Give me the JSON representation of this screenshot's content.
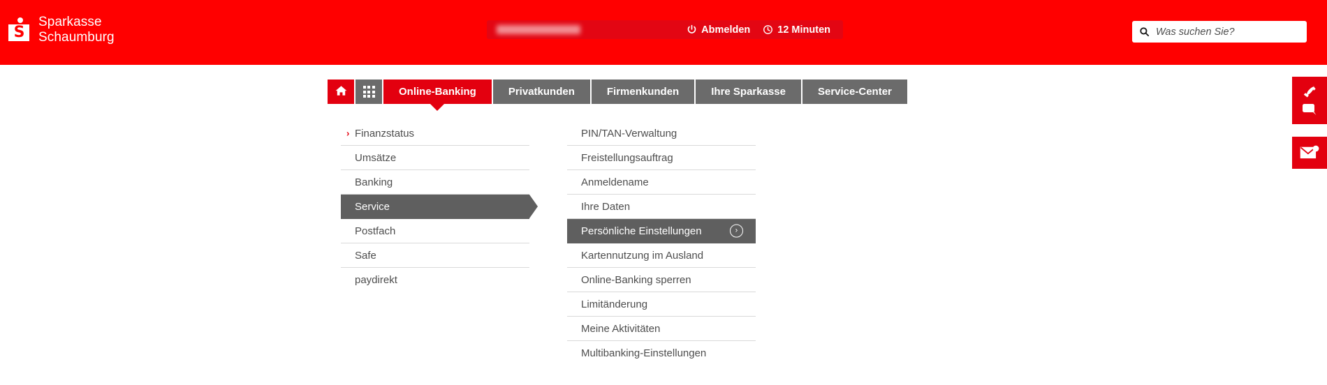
{
  "brand": {
    "name": "Sparkasse\nSchaumburg",
    "logo_letter": "S",
    "primary_color": "#ff0000",
    "accent_color": "#e3000f",
    "menu_selected_color": "#5f5f5f",
    "nav_inactive_color": "#6b6b6b"
  },
  "session": {
    "username_masked": "",
    "logout_label": "Abmelden",
    "timer_label": "12 Minuten",
    "power_icon": "power-icon",
    "clock_icon": "clock-icon"
  },
  "search": {
    "placeholder": "Was suchen Sie?",
    "value": "",
    "icon": "search-icon"
  },
  "nav": {
    "home_icon": "home-icon",
    "grid_icon": "grid-apps-icon",
    "tabs": [
      {
        "label": "Online-Banking",
        "active": true
      },
      {
        "label": "Privatkunden",
        "active": false
      },
      {
        "label": "Firmenkunden",
        "active": false
      },
      {
        "label": "Ihre Sparkasse",
        "active": false
      },
      {
        "label": "Service-Center",
        "active": false
      }
    ]
  },
  "mega_menu": {
    "left_column": [
      {
        "label": "Finanzstatus",
        "selected": false,
        "chevron": true
      },
      {
        "label": "Umsätze",
        "selected": false,
        "chevron": false
      },
      {
        "label": "Banking",
        "selected": false,
        "chevron": false
      },
      {
        "label": "Service",
        "selected": true,
        "chevron": false
      },
      {
        "label": "Postfach",
        "selected": false,
        "chevron": false
      },
      {
        "label": "Safe",
        "selected": false,
        "chevron": false
      },
      {
        "label": "paydirekt",
        "selected": false,
        "chevron": false
      }
    ],
    "right_column": [
      {
        "label": "PIN/TAN-Verwaltung",
        "selected": false
      },
      {
        "label": "Freistellungsauftrag",
        "selected": false
      },
      {
        "label": "Anmeldename",
        "selected": false
      },
      {
        "label": "Ihre Daten",
        "selected": false
      },
      {
        "label": "Persönliche Einstellungen",
        "selected": true,
        "circle_chevron": "›"
      },
      {
        "label": "Kartennutzung im Ausland",
        "selected": false
      },
      {
        "label": "Online-Banking sperren",
        "selected": false
      },
      {
        "label": "Limitänderung",
        "selected": false
      },
      {
        "label": "Meine Aktivitäten",
        "selected": false
      },
      {
        "label": "Multibanking-Einstellungen",
        "selected": false
      }
    ]
  },
  "side_rail": {
    "buttons": [
      {
        "name": "phone-icon"
      },
      {
        "name": "chat-bubble-icon"
      },
      {
        "name": "mail-icon"
      }
    ]
  }
}
